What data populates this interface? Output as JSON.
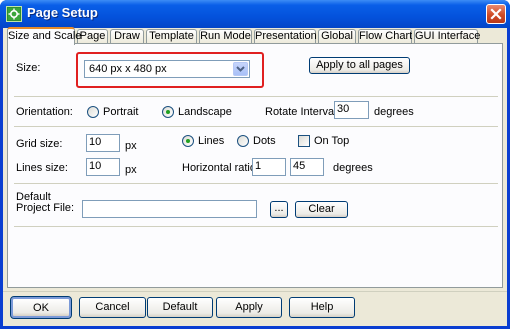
{
  "window": {
    "title": "Page Setup"
  },
  "tabs": [
    {
      "label": "Size and Scale",
      "active": true
    },
    {
      "label": "Page",
      "active": false
    },
    {
      "label": "Draw",
      "active": false
    },
    {
      "label": "Template",
      "active": false
    },
    {
      "label": "Run Mode",
      "active": false
    },
    {
      "label": "Presentation",
      "active": false
    },
    {
      "label": "Global",
      "active": false
    },
    {
      "label": "Flow Chart",
      "active": false
    },
    {
      "label": "GUI Interface",
      "active": false
    }
  ],
  "size": {
    "label": "Size:",
    "selected": "640 px x 480 px",
    "apply_all_label": "Apply to all pages"
  },
  "orientation": {
    "label": "Orientation:",
    "options": [
      "Portrait",
      "Landscape"
    ],
    "selected": "Landscape",
    "rotate_label": "Rotate Interval:",
    "rotate_value": "30",
    "rotate_unit": "degrees"
  },
  "grid": {
    "size_label": "Grid size:",
    "size_value": "10",
    "size_unit": "px",
    "style_options": [
      "Lines",
      "Dots"
    ],
    "style_selected": "Lines",
    "on_top_label": "On Top",
    "on_top_checked": false,
    "lines_size_label": "Lines size:",
    "lines_size_value": "10",
    "lines_size_unit": "px",
    "ratio_label": "Horizontal ratio:",
    "ratio_a": "1",
    "ratio_b": "45",
    "ratio_unit": "degrees"
  },
  "project": {
    "label_line1": "Default",
    "label_line2": "Project File:",
    "file_value": "",
    "browse_label": "...",
    "clear_label": "Clear"
  },
  "footer": {
    "ok_label": "OK",
    "cancel_label": "Cancel",
    "default_label": "Default",
    "apply_label": "Apply",
    "help_label": "Help"
  },
  "colors": {
    "titlebar": "#0452dc",
    "highlight": "#e02020",
    "tab_accent": "#e68b2c"
  }
}
